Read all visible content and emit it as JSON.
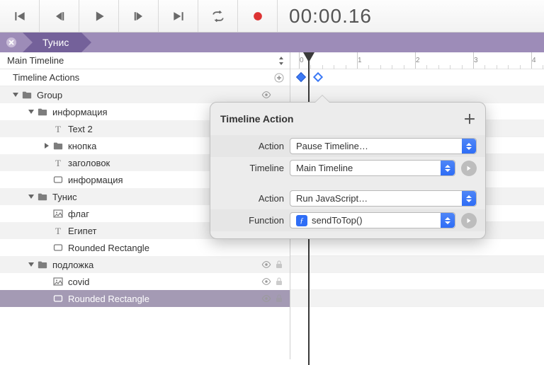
{
  "transport": {
    "timecode": "00:00.16"
  },
  "breadcrumb": {
    "scene": "Тунис"
  },
  "left": {
    "timeline_name": "Main Timeline",
    "actions_label": "Timeline Actions"
  },
  "tree": [
    {
      "depth": 0,
      "toggle": "open",
      "icon": "folder",
      "label": "Group",
      "eye": true
    },
    {
      "depth": 1,
      "toggle": "open",
      "icon": "folder",
      "label": "информация"
    },
    {
      "depth": 2,
      "toggle": null,
      "icon": "text",
      "label": "Text 2"
    },
    {
      "depth": 2,
      "toggle": "closed",
      "icon": "folder",
      "label": "кнопка"
    },
    {
      "depth": 2,
      "toggle": null,
      "icon": "text",
      "label": "заголовок"
    },
    {
      "depth": 2,
      "toggle": null,
      "icon": "rect",
      "label": "информация"
    },
    {
      "depth": 1,
      "toggle": "open",
      "icon": "folder",
      "label": "Тунис"
    },
    {
      "depth": 2,
      "toggle": null,
      "icon": "image",
      "label": "флаг"
    },
    {
      "depth": 2,
      "toggle": null,
      "icon": "text",
      "label": "Египет"
    },
    {
      "depth": 2,
      "toggle": null,
      "icon": "rect",
      "label": "Rounded Rectangle"
    },
    {
      "depth": 1,
      "toggle": "open",
      "icon": "folder",
      "label": "подложка",
      "eye": true,
      "lock": true
    },
    {
      "depth": 2,
      "toggle": null,
      "icon": "image",
      "label": "covid",
      "eye": true,
      "lock": true
    },
    {
      "depth": 2,
      "toggle": null,
      "icon": "rect",
      "label": "Rounded Rectangle",
      "eye": true,
      "lock": true,
      "selected": true
    }
  ],
  "ruler": {
    "ticks": [
      0,
      1,
      2,
      3,
      4
    ]
  },
  "keyframes": {
    "row": 0,
    "positions": [
      10,
      34
    ]
  },
  "popover": {
    "title": "Timeline Action",
    "rows": [
      {
        "label": "Action",
        "value": "Pause Timeline…",
        "go": false
      },
      {
        "label": "Timeline",
        "value": "Main Timeline",
        "go": true
      },
      {
        "spacer": true
      },
      {
        "label": "Action",
        "value": "Run JavaScript…",
        "go": false
      },
      {
        "label": "Function",
        "value": "sendToTop()",
        "go": true,
        "fn": true
      }
    ]
  }
}
